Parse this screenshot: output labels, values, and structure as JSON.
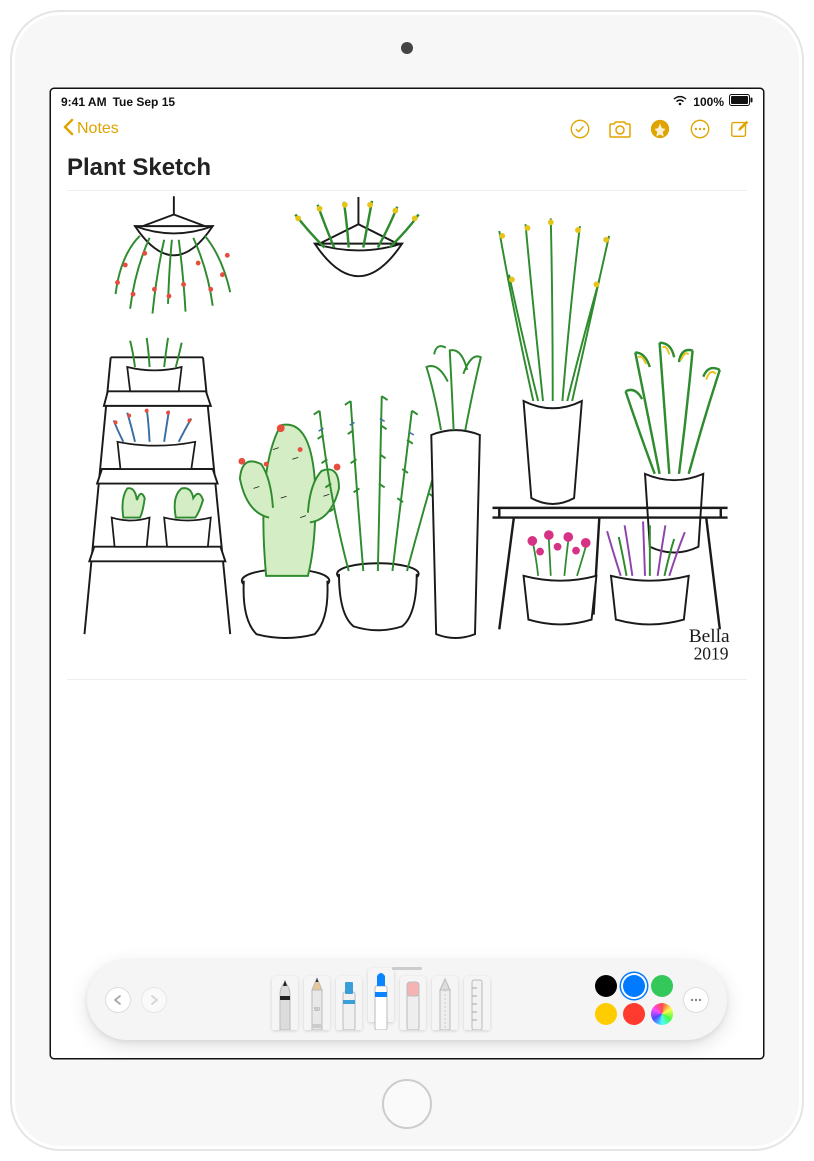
{
  "status": {
    "time": "9:41 AM",
    "date": "Tue Sep 15",
    "battery": "100%"
  },
  "nav": {
    "back_label": "Notes"
  },
  "note": {
    "title": "Plant Sketch",
    "signature_name": "Bella",
    "signature_year": "2019"
  },
  "toolbar": {
    "colors": {
      "black": "#000000",
      "blue": "#007aff",
      "green": "#34c759",
      "yellow": "#ffcc00",
      "red": "#ff3b30"
    },
    "selected_color": "blue",
    "tools": [
      "pen",
      "pencil",
      "highlighter",
      "marker",
      "eraser",
      "lasso",
      "ruler"
    ],
    "selected_tool": "marker"
  }
}
